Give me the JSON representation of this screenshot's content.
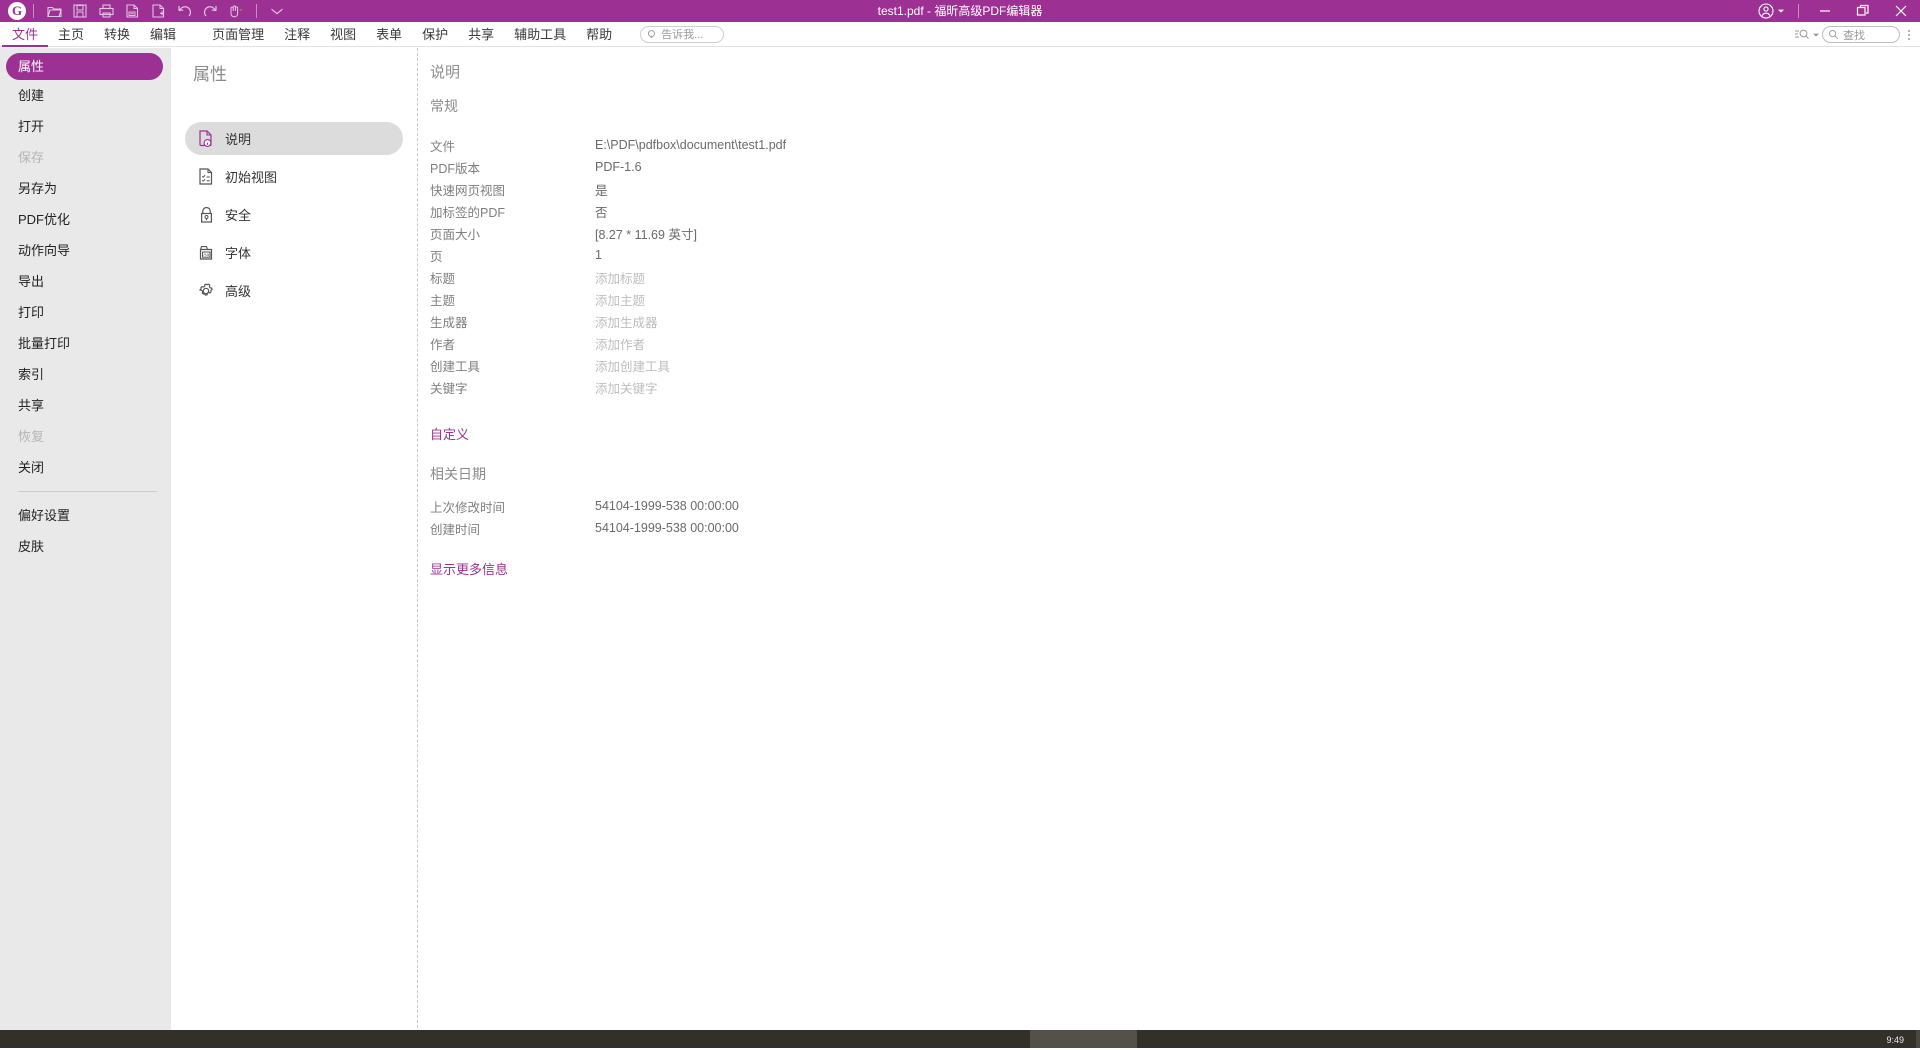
{
  "titlebar": {
    "logo_text": "G",
    "title": "test1.pdf - 福昕高级PDF编辑器",
    "quick_icons": [
      {
        "name": "open-folder-icon",
        "label": "打开"
      },
      {
        "name": "save-icon",
        "label": "保存"
      },
      {
        "name": "print-icon",
        "label": "打印"
      },
      {
        "name": "remove-page-icon",
        "label": "删除页面"
      },
      {
        "name": "add-page-icon",
        "label": "添加页面"
      },
      {
        "name": "undo-icon",
        "label": "撤销"
      },
      {
        "name": "redo-icon",
        "label": "重做"
      },
      {
        "name": "hand-tool-icon",
        "label": "手型工具"
      },
      {
        "name": "customize-toolbar-icon",
        "label": "自定义工具栏"
      }
    ],
    "account_icon": "account-icon",
    "minimize_label": "最小化",
    "restore_label": "还原",
    "close_label": "关闭"
  },
  "menubar": {
    "left_items": [
      {
        "label": "文件",
        "active": true
      },
      {
        "label": "主页",
        "active": false
      },
      {
        "label": "转换",
        "active": false
      },
      {
        "label": "编辑",
        "active": false
      }
    ],
    "mid_items": [
      {
        "label": "页面管理"
      },
      {
        "label": "注释"
      },
      {
        "label": "视图"
      },
      {
        "label": "表单"
      },
      {
        "label": "保护"
      },
      {
        "label": "共享"
      },
      {
        "label": "辅助工具"
      },
      {
        "label": "帮助"
      }
    ],
    "tellme_placeholder": "告诉我...",
    "find_placeholder": "查找",
    "search_options_icon": "search-options-icon",
    "more-options-icon": "more-options-icon"
  },
  "sidebar": {
    "items": [
      {
        "label": "属性",
        "state": "selected"
      },
      {
        "label": "创建",
        "state": "normal"
      },
      {
        "label": "打开",
        "state": "normal"
      },
      {
        "label": "保存",
        "state": "disabled"
      },
      {
        "label": "另存为",
        "state": "normal"
      },
      {
        "label": "PDF优化",
        "state": "normal"
      },
      {
        "label": "动作向导",
        "state": "normal"
      },
      {
        "label": "导出",
        "state": "normal"
      },
      {
        "label": "打印",
        "state": "normal"
      },
      {
        "label": "批量打印",
        "state": "normal"
      },
      {
        "label": "索引",
        "state": "normal"
      },
      {
        "label": "共享",
        "state": "normal"
      },
      {
        "label": "恢复",
        "state": "disabled"
      },
      {
        "label": "关闭",
        "state": "normal"
      }
    ],
    "footer_items": [
      {
        "label": "偏好设置",
        "state": "normal"
      },
      {
        "label": "皮肤",
        "state": "normal"
      }
    ]
  },
  "properties_panel": {
    "title": "属性",
    "tabs": [
      {
        "label": "说明",
        "icon": "document-info-icon",
        "active": true
      },
      {
        "label": "初始视图",
        "icon": "initial-view-icon",
        "active": false
      },
      {
        "label": "安全",
        "icon": "lock-icon",
        "active": false
      },
      {
        "label": "字体",
        "icon": "font-icon",
        "active": false
      },
      {
        "label": "高级",
        "icon": "gear-icon",
        "active": false
      }
    ]
  },
  "content": {
    "heading": "说明",
    "general_heading": "常规",
    "general_rows": [
      {
        "key": "文件",
        "value": "E:\\PDF\\pdfbox\\document\\test1.pdf",
        "placeholder": false
      },
      {
        "key": "PDF版本",
        "value": "PDF-1.6",
        "placeholder": false
      },
      {
        "key": "快速网页视图",
        "value": "是",
        "placeholder": false
      },
      {
        "key": "加标签的PDF",
        "value": "否",
        "placeholder": false
      },
      {
        "key": "页面大小",
        "value": "[8.27 * 11.69 英寸]",
        "placeholder": false
      },
      {
        "key": "页",
        "value": "1",
        "placeholder": false
      },
      {
        "key": "标题",
        "value": "添加标题",
        "placeholder": true
      },
      {
        "key": "主题",
        "value": "添加主题",
        "placeholder": true
      },
      {
        "key": "生成器",
        "value": "添加生成器",
        "placeholder": true
      },
      {
        "key": "作者",
        "value": "添加作者",
        "placeholder": true
      },
      {
        "key": "创建工具",
        "value": "添加创建工具",
        "placeholder": true
      },
      {
        "key": "关键字",
        "value": "添加关键字",
        "placeholder": true
      }
    ],
    "custom_link": "自定义",
    "dates_heading": "相关日期",
    "date_rows": [
      {
        "key": "上次修改时间",
        "value": "54104-1999-538 00:00:00"
      },
      {
        "key": "创建时间",
        "value": "54104-1999-538 00:00:00"
      }
    ],
    "more_link": "显示更多信息"
  },
  "taskbar": {
    "clock": "9:49"
  },
  "colors": {
    "brand": "#9C3193",
    "sidebar_bg": "#e9e9e9",
    "tab_active_bg": "#dcdcdc",
    "text_muted": "#7f7f7f",
    "placeholder": "#bdbdbd"
  }
}
